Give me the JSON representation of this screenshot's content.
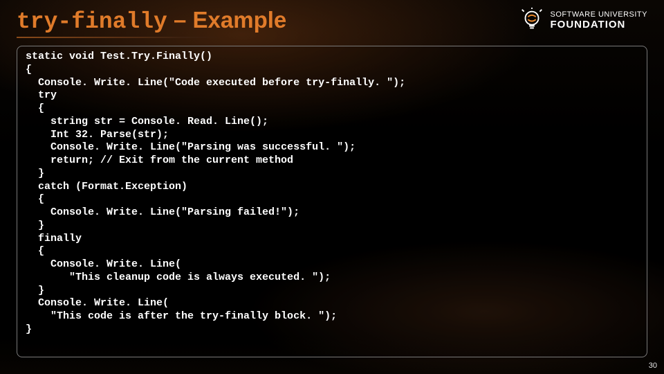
{
  "title": {
    "code": "try-finally",
    "sep": " – ",
    "rest": "Example"
  },
  "logo": {
    "line1": "SOFTWARE UNIVERSITY",
    "line2": "FOUNDATION"
  },
  "code_lines": [
    "static void Test.Try.Finally()",
    "{",
    "  Console. Write. Line(\"Code executed before try-finally. \");",
    "  try",
    "  {",
    "    string str = Console. Read. Line();",
    "    Int 32. Parse(str);",
    "    Console. Write. Line(\"Parsing was successful. \");",
    "    return; // Exit from the current method",
    "  }",
    "  catch (Format.Exception)",
    "  {",
    "    Console. Write. Line(\"Parsing failed!\");",
    "  }",
    "  finally",
    "  {",
    "    Console. Write. Line(",
    "       \"This cleanup code is always executed. \");",
    "  }",
    "  Console. Write. Line(",
    "    \"This code is after the try-finally block. \");",
    "}"
  ],
  "page_number": "30"
}
